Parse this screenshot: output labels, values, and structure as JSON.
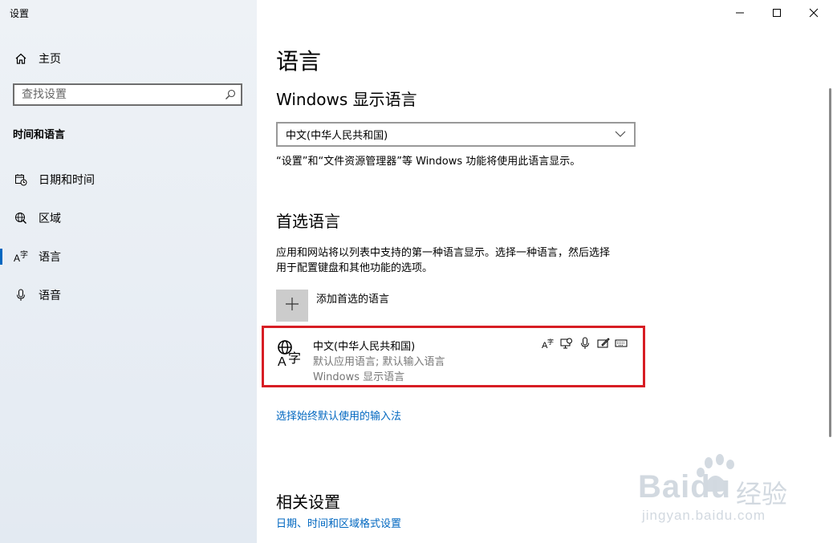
{
  "window": {
    "title": "设置",
    "controls": [
      "minimize-icon",
      "maximize-icon",
      "close-icon"
    ]
  },
  "sidebar": {
    "home_label": "主页",
    "search_placeholder": "查找设置",
    "section_title": "时间和语言",
    "items": [
      {
        "label": "日期和时间",
        "icon": "calendar-clock-icon"
      },
      {
        "label": "区域",
        "icon": "globe-region-icon"
      },
      {
        "label": "语言",
        "icon": "language-icon",
        "active": true
      },
      {
        "label": "语音",
        "icon": "microphone-icon"
      }
    ]
  },
  "main": {
    "page_title": "语言",
    "display_language": {
      "heading": "Windows 显示语言",
      "selected": "中文(中华人民共和国)",
      "note": "“设置”和“文件资源管理器”等 Windows 功能将使用此语言显示。"
    },
    "preferred": {
      "heading": "首选语言",
      "description_line1": "应用和网站将以列表中支持的第一种语言显示。选择一种语言，然后选择",
      "description_line2": "用于配置键盘和其他功能的选项。",
      "add_label": "添加首选的语言",
      "language": {
        "name": "中文(中华人民共和国)",
        "detail1": "默认应用语言; 默认输入语言",
        "detail2": "Windows 显示语言",
        "features": [
          "display-language-icon",
          "speech-recognition-icon",
          "microphone-icon",
          "handwriting-icon",
          "keyboard-icon"
        ]
      },
      "input_link": "选择始终默认使用的输入法"
    },
    "related": {
      "heading": "相关设置",
      "link": "日期、时间和区域格式设置"
    }
  },
  "watermark": {
    "brand": "Baidu",
    "brand_cn": "经验",
    "url": "jingyan.baidu.com"
  },
  "colors": {
    "accent": "#0067c0",
    "highlight_border": "#d71d24",
    "sidebar_bg": "#e9eef4"
  }
}
